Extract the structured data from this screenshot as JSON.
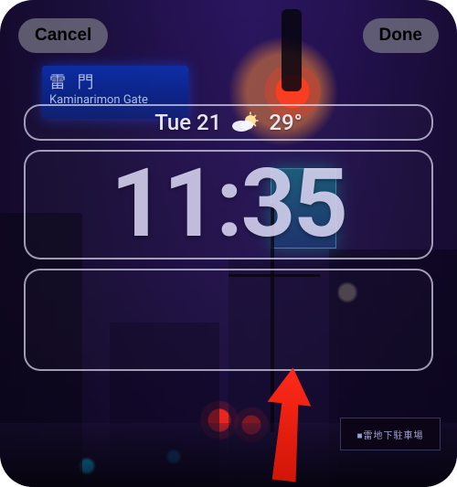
{
  "topbar": {
    "cancel_label": "Cancel",
    "done_label": "Done"
  },
  "date_widget": {
    "date_text": "Tue 21",
    "weather_icon": "partly-cloudy-icon",
    "temperature_text": "29°"
  },
  "time_widget": {
    "time_text": "11:35"
  },
  "bottom_widget": {
    "is_empty": true
  },
  "background": {
    "sign_top_jp": "雷 門",
    "sign_top_en": "Kaminarimon Gate",
    "sign_bottom_text": "■雷地下駐車場"
  },
  "annotation": {
    "type": "arrow",
    "color": "#ff2a1a",
    "points_to": "bottom-widget-slot"
  }
}
